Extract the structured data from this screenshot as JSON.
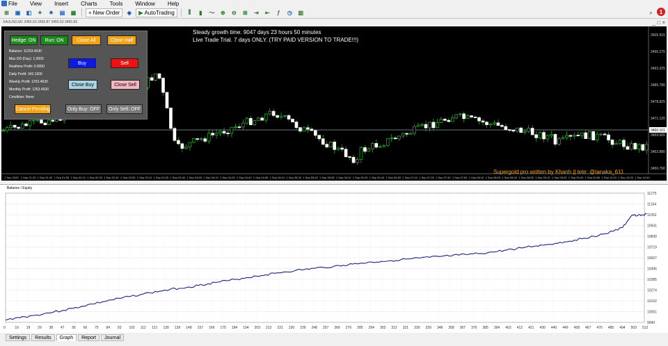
{
  "menu": {
    "items": [
      "File",
      "View",
      "Insert",
      "Charts",
      "Tools",
      "Window",
      "Help"
    ]
  },
  "toolbar": {
    "new_order": "New Order",
    "autotrading": "AutoTrading"
  },
  "notifications": {
    "count": "1"
  },
  "chart": {
    "symbol_line": "XAUUSD,M1 3455.63 3455.87 3455.53 3455.83",
    "overlay_line1": "Steady growth time. 9047 days 23 hours 50 minutes",
    "overlay_line2": "Live Trade Trial. 7 days ONLY. (TRY PAID VERSION TO TRADE!!!)",
    "signature": "Supergold pro written by Khanh || tele: @tanaka_611",
    "price_labels": [
      "3505.915",
      "3495.275",
      "3493.325",
      "3485.780",
      "3478.825",
      "3471.120",
      "3459.065",
      "3453.880",
      "3450.790"
    ],
    "current_price": "3460.101",
    "time_labels": [
      "1 Sep 2025",
      "1 Sep 01:25",
      "1 Sep 01:40",
      "1 Sep 01:55",
      "1 Sep 02:10",
      "1 Sep 02:25",
      "1 Sep 02:40",
      "1 Sep 02:55",
      "1 Sep 03:10",
      "1 Sep 03:25",
      "1 Sep 03:40",
      "1 Sep 03:55",
      "1 Sep 04:10",
      "1 Sep 04:25",
      "1 Sep 04:40",
      "1 Sep 04:55",
      "1 Sep 05:10",
      "1 Sep 05:25",
      "1 Sep 05:40",
      "1 Sep 05:55",
      "1 Sep 06:10",
      "1 Sep 06:25",
      "1 Sep 06:40",
      "1 Sep 06:55",
      "1 Sep 07:10",
      "1 Sep 07:25",
      "1 Sep 07:40",
      "1 Sep 07:55",
      "1 Sep 08:10",
      "1 Sep 08:25",
      "1 Sep 08:40",
      "1 Sep 08:55",
      "1 Sep 09:10",
      "1 Sep 09:25",
      "1 Sep 09:40",
      "1 Sep 09:55",
      "1 Sep 10:10",
      "1 Sep 10:25",
      "1 Sep 10:40"
    ]
  },
  "panel": {
    "hedge": "Hedge: ON",
    "run": "Run: ON",
    "close_all": "Close All",
    "close_half": "Close Half",
    "buy": "Buy",
    "sell": "Sell",
    "close_buy": "Close Buy",
    "close_sell": "Close Sell",
    "cancel_pending": "Cancel Pending",
    "only_buy": "Only Buy: OFF",
    "only_sell": "Only Sell: OFF",
    "stats": [
      "Balance: 11253.4630",
      "Max DD (Day): 1.0000",
      "Realtime Profit: 0.0000",
      "Daily Profit: 342.1000",
      "Weekly Profit: 1253.4630",
      "Monthly Profit: 1253.4630",
      "Condition: None"
    ]
  },
  "colors": {
    "hedge_bg": "#1a8a1a",
    "close_all_bg": "#f3a216",
    "buy_bg": "#0a18e8",
    "sell_bg": "#f01010",
    "close_buy_bg": "#a9d4e6",
    "close_sell_bg": "#f4b8c2",
    "gray_btn_bg": "#7a7a7a",
    "bull": "#2ca52c",
    "bear": "#ffffff",
    "equity": "#1a237e"
  },
  "tester": {
    "legend": "Balance / Equity",
    "y_labels": [
      "11275",
      "11164",
      "11052",
      "10941",
      "10830",
      "10719",
      "10607",
      "10496",
      "10385",
      "10274",
      "10162",
      "10051",
      "9940"
    ],
    "x_labels": [
      "0",
      "10",
      "19",
      "29",
      "38",
      "47",
      "56",
      "66",
      "75",
      "84",
      "93",
      "102",
      "112",
      "121",
      "130",
      "139",
      "148",
      "157",
      "166",
      "175",
      "184",
      "194",
      "203",
      "212",
      "221",
      "230",
      "239",
      "248",
      "257",
      "266",
      "276",
      "285",
      "294",
      "303",
      "312",
      "321",
      "330",
      "339",
      "348",
      "358",
      "367",
      "376",
      "385",
      "394",
      "403",
      "412",
      "421",
      "430",
      "440",
      "449",
      "458",
      "467",
      "476",
      "485",
      "494",
      "503",
      "512"
    ],
    "chart_data": {
      "type": "line",
      "series": [
        {
          "name": "Balance",
          "values": [
            9962,
            9985,
            9998,
            10012,
            10030,
            10048,
            10065,
            10085,
            10108,
            10130,
            10150,
            10172,
            10190,
            10210,
            10228,
            10245,
            10262,
            10278,
            10292,
            10305,
            10322,
            10340,
            10356,
            10370,
            10386,
            10402,
            10418,
            10432,
            10448,
            10462,
            10474,
            10486,
            10498,
            10508,
            10518,
            10530,
            10542,
            10552,
            10562,
            10570,
            10578,
            10588,
            10596,
            10604,
            10612,
            10620,
            10626,
            10634,
            10642,
            10650,
            10660,
            10672,
            10688,
            10702,
            10718,
            10730,
            10742,
            10756,
            10772,
            10790,
            10810,
            10830,
            10852,
            10880,
            10920,
            10990,
            11050,
            11040,
            11050,
            11060
          ]
        }
      ],
      "x": [
        0,
        8,
        16,
        24,
        32,
        40,
        48,
        56,
        64,
        72,
        80,
        88,
        96,
        104,
        112,
        120,
        128,
        136,
        144,
        152,
        160,
        168,
        176,
        184,
        192,
        200,
        208,
        216,
        224,
        232,
        240,
        248,
        256,
        264,
        272,
        280,
        288,
        296,
        304,
        312,
        320,
        328,
        336,
        344,
        352,
        360,
        368,
        376,
        384,
        392,
        400,
        408,
        416,
        424,
        432,
        440,
        448,
        456,
        464,
        472,
        480,
        488,
        496,
        504,
        512,
        516,
        520,
        524,
        528,
        532
      ],
      "ylim": [
        9940,
        11275
      ],
      "xlim": [
        0,
        530
      ],
      "grid": true
    }
  },
  "tabs": [
    "Settings",
    "Results",
    "Graph",
    "Report",
    "Journal"
  ],
  "active_tab": "Graph"
}
